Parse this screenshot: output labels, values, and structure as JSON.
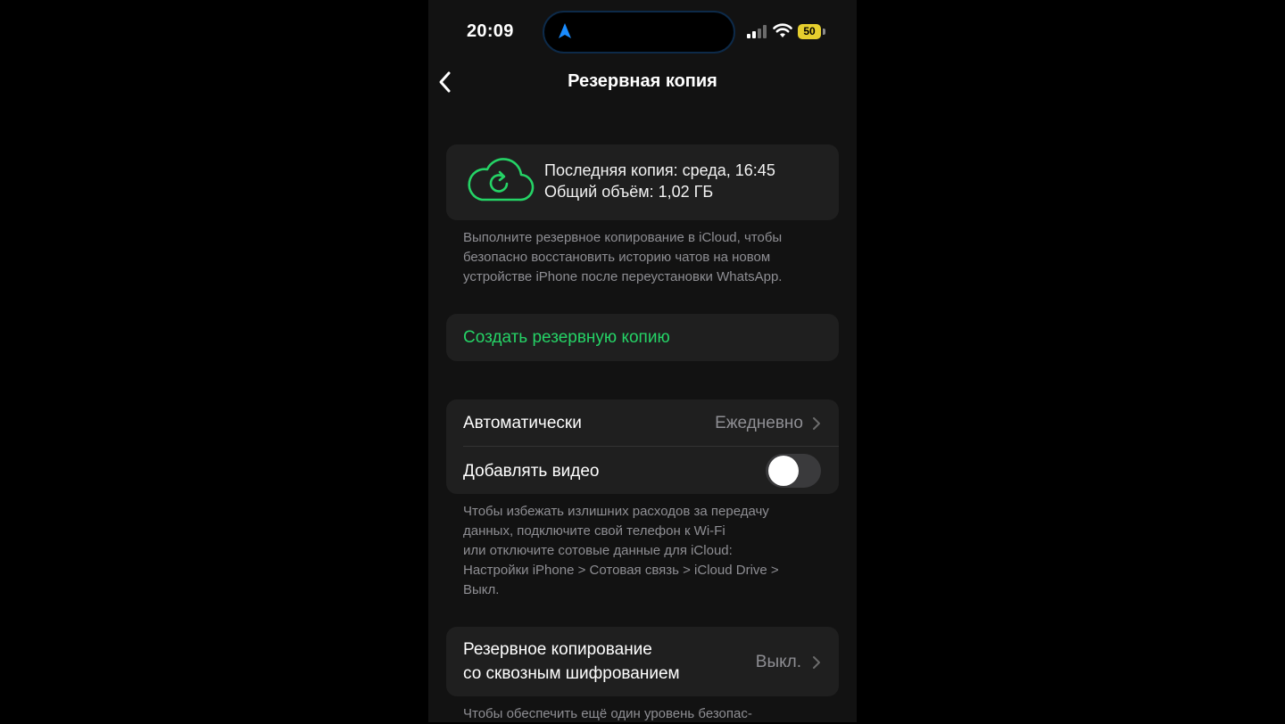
{
  "status_bar": {
    "time": "20:09",
    "battery": "50"
  },
  "header": {
    "title": "Резервная копия"
  },
  "backup_summary": {
    "last_backup": "Последняя копия: среда, 16:45",
    "total_size": "Общий объём: 1,02 ГБ"
  },
  "backup_description": [
    "Выполните резервное копирование в iCloud, чтобы",
    "безопасно восстановить историю чатов на новом",
    "устройстве iPhone после переустановки WhatsApp."
  ],
  "create_backup_label": "Создать резервную копию",
  "settings": {
    "auto_label": "Автоматически",
    "auto_value": "Ежедневно",
    "video_label": "Добавлять видео",
    "video_enabled": false
  },
  "data_note": [
    "Чтобы избежать излишних расходов за передачу",
    "данных, подключите свой телефон к Wi-Fi",
    "или отключите сотовые данные для iCloud:",
    "Настройки iPhone > Сотовая связь > iCloud Drive >",
    "Выкл."
  ],
  "e2e": {
    "label_line1": "Резервное копирование",
    "label_line2": "со сквозным шифрованием",
    "value": "Выкл."
  },
  "footer_partial": "Чтобы обеспечить ещё один уровень безопас-",
  "colors": {
    "accent_green": "#25d366",
    "card_bg": "#1f1f1f",
    "secondary_text": "#8e8e93",
    "battery_yellow": "#e6cf2e"
  }
}
